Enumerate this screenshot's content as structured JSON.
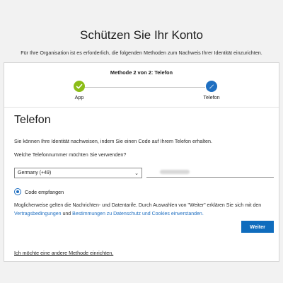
{
  "header": {
    "title": "Schützen Sie Ihr Konto",
    "subtitle": "Für Ihre Organisation ist es erforderlich, die folgenden Methoden zum Nachweis Ihrer Identität einzurichten."
  },
  "stepper": {
    "title": "Methode 2 von 2: Telefon",
    "steps": [
      {
        "label": "App",
        "state": "completed",
        "icon": "checkmark-icon",
        "color": "#8cbd18"
      },
      {
        "label": "Telefon",
        "state": "current",
        "icon": "phone-step-icon",
        "color": "#1f6fc1"
      }
    ]
  },
  "section": {
    "title": "Telefon",
    "description": "Sie können Ihre Identität nachweisen, indem Sie einen Code auf Ihrem Telefon erhalten.",
    "question": "Welche Telefonnummer möchten Sie verwenden?"
  },
  "form": {
    "country_value": "Germany (+49)",
    "phone_value": "",
    "radio_label": "Code empfangen",
    "radio_checked": true
  },
  "terms": {
    "text_before": "Moglicherweise gelten die Nachrichten- und Datentarife. Durch Auswahlen von \"Weiter\" erklären Sie sich mit den",
    "link1": "Vertragsbedingungen",
    "and": "und",
    "link2": "Bestimmungen zu Datenschutz und Cookies einverstanden."
  },
  "actions": {
    "next_label": "Weiter",
    "other_method_label": "Ich möchte eine andere Methode einrichten."
  },
  "colors": {
    "accent": "#0f6cbd",
    "success": "#8cbd18",
    "background": "#f2f2f2"
  }
}
